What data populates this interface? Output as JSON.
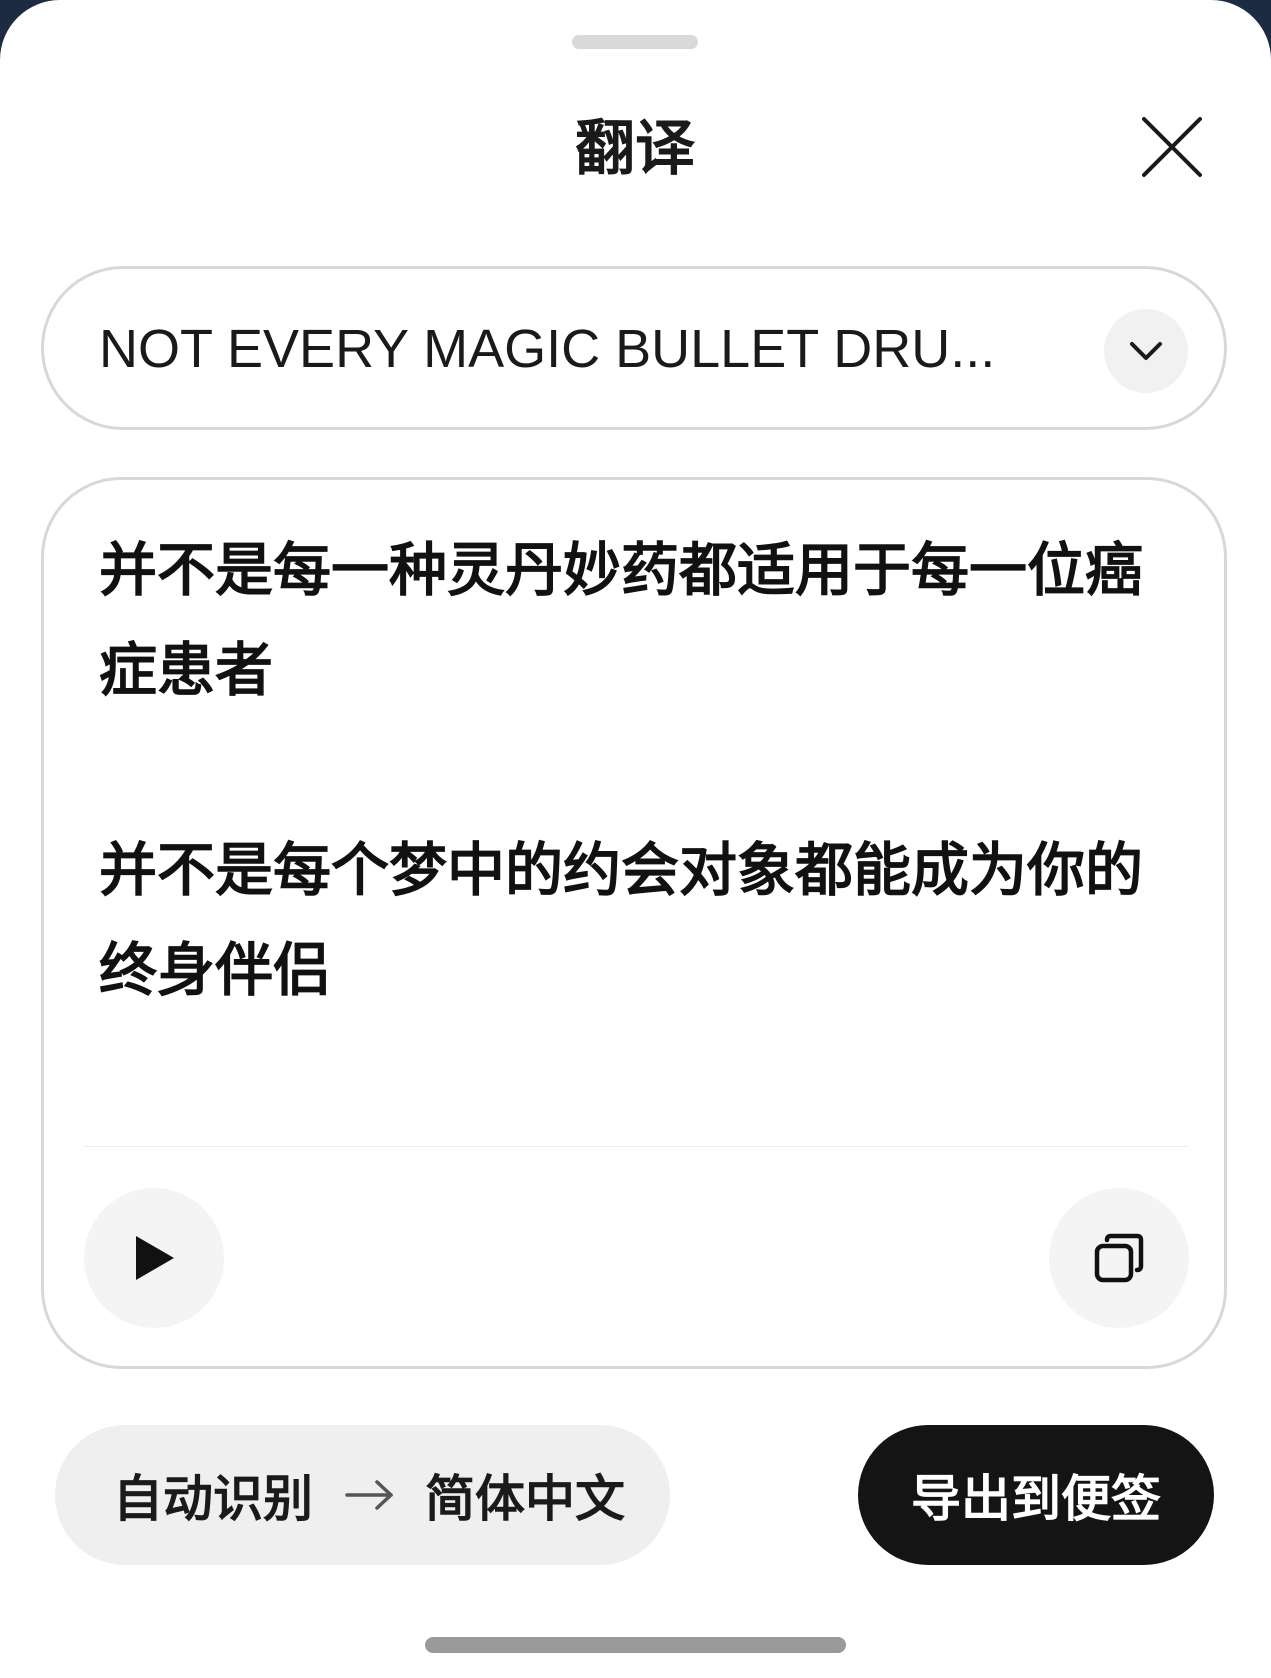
{
  "header": {
    "title": "翻译"
  },
  "source": {
    "text": "NOT EVERY MAGIC BULLET DRU..."
  },
  "result": {
    "paragraphs": [
      "并不是每一种灵丹妙药都适用于每一位癌症患者",
      "并不是每个梦中的约会对象都能成为你的终身伴侣"
    ]
  },
  "language": {
    "from": "自动识别",
    "to": "简体中文"
  },
  "actions": {
    "export_label": "导出到便签"
  },
  "icons": {
    "close": "close-icon",
    "dropdown": "chevron-down-icon",
    "play": "play-icon",
    "copy": "copy-icon",
    "arrow": "arrow-right-icon"
  },
  "colors": {
    "export_button": "#141414",
    "pill_background": "#efefef",
    "border": "#d8d8d8"
  }
}
